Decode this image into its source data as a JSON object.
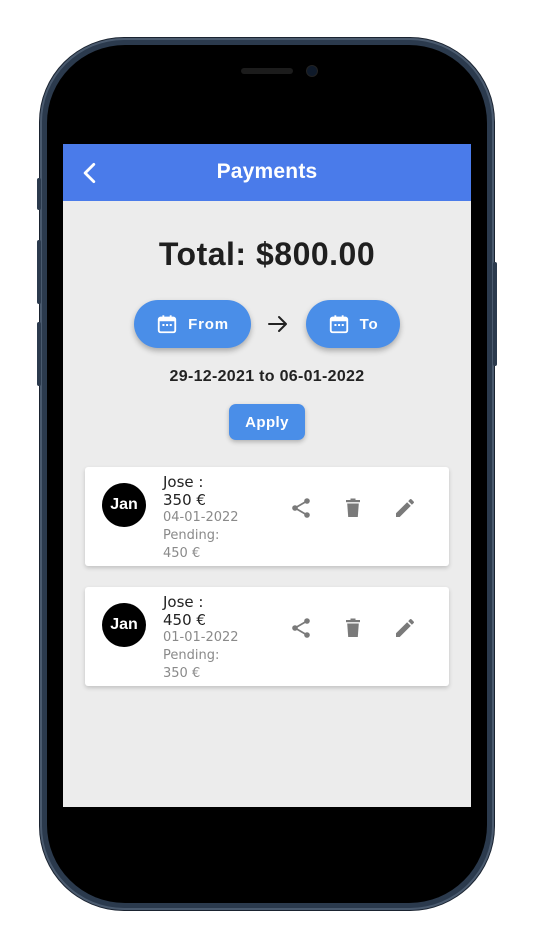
{
  "appbar": {
    "title": "Payments"
  },
  "summary": {
    "total": "Total: $800.00"
  },
  "date_filter": {
    "from_label": "From",
    "to_label": "To",
    "range_text": "29-12-2021 to 06-01-2022",
    "apply_label": "Apply"
  },
  "payments": [
    {
      "avatar": "Jan",
      "name": "Jose :",
      "amount": "350 €",
      "date": "04-01-2022",
      "pending_label": "Pending:",
      "pending_amount": "450 €"
    },
    {
      "avatar": "Jan",
      "name": "Jose :",
      "amount": "450 €",
      "date": "01-01-2022",
      "pending_label": "Pending:",
      "pending_amount": "350 €"
    }
  ],
  "icons": {
    "back": "chevron-left-icon",
    "calendar": "calendar-icon",
    "arrow": "arrow-right-icon",
    "share": "share-icon",
    "delete": "trash-icon",
    "edit": "pencil-icon"
  },
  "colors": {
    "accent": "#4a7bea",
    "button": "#4a8ee8",
    "background": "#ececec",
    "icon_grey": "#7a7a7a"
  }
}
